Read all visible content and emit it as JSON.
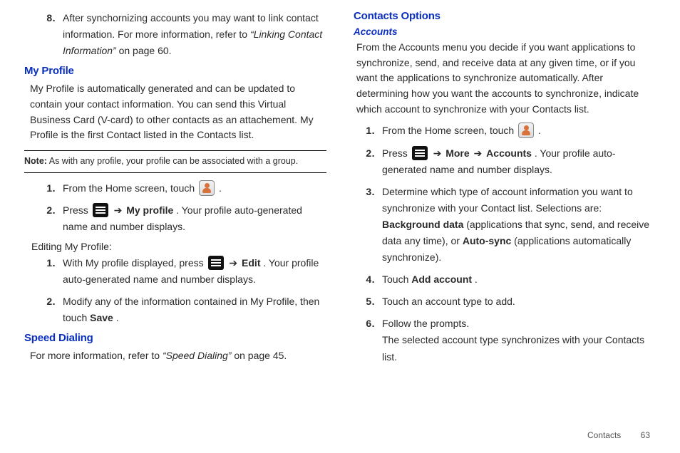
{
  "left": {
    "step8": {
      "num": "8.",
      "pre": "After synchornizing accounts you may want to link contact information. For more information, refer to ",
      "ref": "“Linking Contact Information”",
      "post": "  on page 60."
    },
    "myprofile": {
      "heading": "My Profile",
      "para": "My Profile is automatically generated and can be updated to contain your contact information. You can send this Virtual Business Card (V-card) to other contacts as an attachement. My Profile is the first Contact listed in the Contacts list.",
      "note_label": "Note:",
      "note": " As with any profile, your profile can be associated with a group.",
      "s1_num": "1.",
      "s1_pre": "From the Home screen, touch ",
      "s1_post": " .",
      "s2_num": "2.",
      "s2_pre": "Press ",
      "s2_arrow": " ➔ ",
      "s2_bold": "My profile",
      "s2_post": ". Your profile auto-generated name and number displays.",
      "editing_label": "Editing My Profile:",
      "e1_num": "1.",
      "e1_pre": "With My profile displayed, press ",
      "e1_arrow": " ➔ ",
      "e1_bold": "Edit",
      "e1_post": ". Your profile auto-generated name and number displays.",
      "e2_num": "2.",
      "e2_pre": "Modify any of the information contained in My Profile, then touch ",
      "e2_bold": "Save",
      "e2_post": "."
    },
    "speed": {
      "heading": "Speed Dialing",
      "pre": "For more information, refer to ",
      "ref": "“Speed Dialing”",
      "post": "  on page 45."
    }
  },
  "right": {
    "heading": "Contacts Options",
    "accounts": {
      "heading": "Accounts",
      "para": "From the Accounts menu you decide if you want applications to synchronize, send, and receive data at any given time, or if you want the applications to synchronize automatically. After determining how you want the accounts to synchronize, indicate which account to synchronize with your Contacts list.",
      "s1_num": "1.",
      "s1_pre": "From the Home screen, touch ",
      "s1_post": " .",
      "s2_num": "2.",
      "s2_pre": "Press ",
      "s2_arrow1": " ➔ ",
      "s2_bold1": "More",
      "s2_arrow2": "  ➔ ",
      "s2_bold2": "Accounts",
      "s2_post": ". Your profile auto-generated name and number displays.",
      "s3_num": "3.",
      "s3_pre": "Determine which type of account information you want to synchronize with your Contact list. Selections are: ",
      "s3_bold1": "Background data",
      "s3_mid": " (applications that sync, send, and receive data any time), or ",
      "s3_bold2": "Auto-sync",
      "s3_post": " (applications automatically synchronize).",
      "s4_num": "4.",
      "s4_pre": "Touch ",
      "s4_bold": "Add account",
      "s4_post": ".",
      "s5_num": "5.",
      "s5_txt": "Touch an account type to add.",
      "s6_num": "6.",
      "s6_l1": "Follow the prompts.",
      "s6_l2": "The selected account type synchronizes with your Contacts list."
    }
  },
  "footer": {
    "section": "Contacts",
    "page": "63"
  }
}
